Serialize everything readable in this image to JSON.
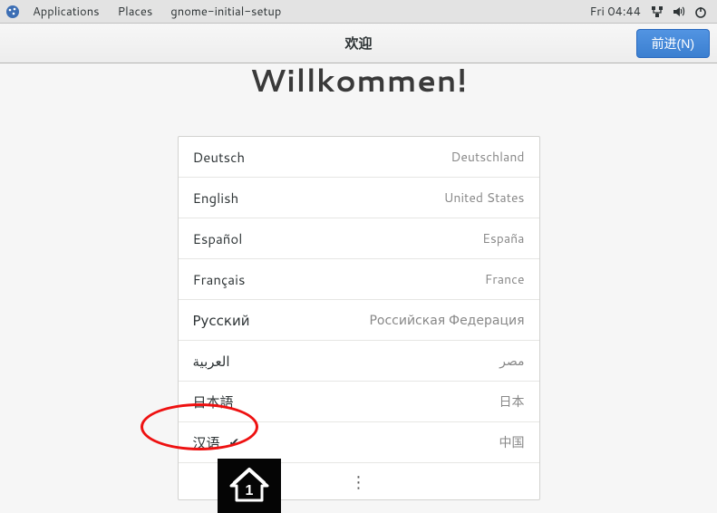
{
  "panel": {
    "applications": "Applications",
    "places": "Places",
    "app_name": "gnome-initial-setup",
    "clock": "Fri 04:44"
  },
  "header": {
    "title": "欢迎",
    "next_label": "前进(N)"
  },
  "welcome_heading": "Willkommen!",
  "languages": [
    {
      "name": "Deutsch",
      "country": "Deutschland",
      "selected": false
    },
    {
      "name": "English",
      "country": "United States",
      "selected": false
    },
    {
      "name": "Español",
      "country": "España",
      "selected": false
    },
    {
      "name": "Français",
      "country": "France",
      "selected": false
    },
    {
      "name": "Русский",
      "country": "Российская Федерация",
      "selected": false
    },
    {
      "name": "العربية",
      "country": "مصر",
      "selected": false
    },
    {
      "name": "日本語",
      "country": "日本",
      "selected": false
    },
    {
      "name": "汉语",
      "country": "中国",
      "selected": true
    }
  ],
  "checkmark": "✔",
  "more_glyph": "⋮"
}
